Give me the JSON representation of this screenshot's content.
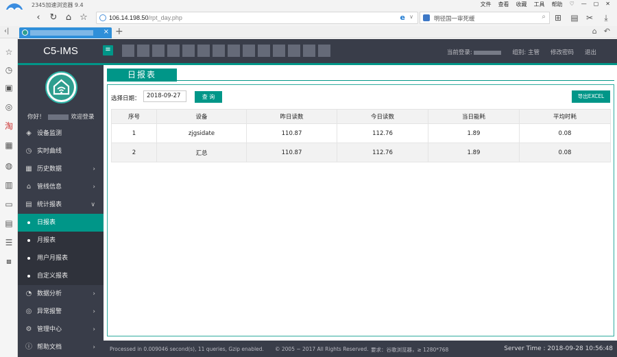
{
  "browser": {
    "app_title": "2345加速浏览器 9.4",
    "menu": [
      "文件",
      "查看",
      "收藏",
      "工具",
      "帮助"
    ],
    "url_host": "106.14.198.50",
    "url_path": "/rpt_day.php",
    "search_text": "明径国一审死缓"
  },
  "header": {
    "brand": "C5-IMS",
    "current_login_label": "当前登录:",
    "group_label": "组别: 主管",
    "change_password": "修改密码",
    "logout": "退出"
  },
  "sidebar": {
    "greeting_prefix": "你好！",
    "greeting_suffix": "欢迎登录",
    "items": [
      {
        "label": "设备监测",
        "icon": "layers-icon",
        "has_arrow": false
      },
      {
        "label": "实时曲线",
        "icon": "clock-icon",
        "has_arrow": false
      },
      {
        "label": "历史数据",
        "icon": "calendar-icon",
        "has_arrow": true
      },
      {
        "label": "管线信息",
        "icon": "home-icon",
        "has_arrow": true
      },
      {
        "label": "统计报表",
        "icon": "document-icon",
        "has_arrow": true,
        "open": true
      }
    ],
    "sub_items": [
      {
        "label": "日报表",
        "active": true
      },
      {
        "label": "月报表",
        "active": false
      },
      {
        "label": "用户月报表",
        "active": false
      },
      {
        "label": "自定义报表",
        "active": false
      }
    ],
    "items_after": [
      {
        "label": "数据分析",
        "icon": "chart-icon"
      },
      {
        "label": "异常报警",
        "icon": "alarm-icon"
      },
      {
        "label": "管理中心",
        "icon": "gear-icon"
      },
      {
        "label": "帮助文档",
        "icon": "info-icon"
      }
    ]
  },
  "page": {
    "tab_title": "日报表",
    "date_label": "选择日期：",
    "date_value": "2018-09-27",
    "query_button": "查 询",
    "export_button": "导出EXCEL",
    "table": {
      "headers": [
        "序号",
        "设备",
        "昨日读数",
        "今日读数",
        "当日能耗",
        "平均时耗"
      ],
      "rows": [
        [
          "1",
          "zjgsidate",
          "110.87",
          "112.76",
          "1.89",
          "0.08"
        ],
        [
          "2",
          "汇总",
          "110.87",
          "112.76",
          "1.89",
          "0.08"
        ]
      ]
    }
  },
  "footer": {
    "processed": "Processed in 0.009046 second(s), 11 queries, Gzip enabled.",
    "copyright": "© 2005 ~ 2017 All Rights Reserved.",
    "requirement": "要求：谷歌浏览器，≥ 1280*768",
    "server_time": "Server Time : 2018-09-28 10:56:48"
  },
  "colors": {
    "accent": "#009688",
    "dark": "#393d49",
    "sub_dark": "#2f323b"
  }
}
